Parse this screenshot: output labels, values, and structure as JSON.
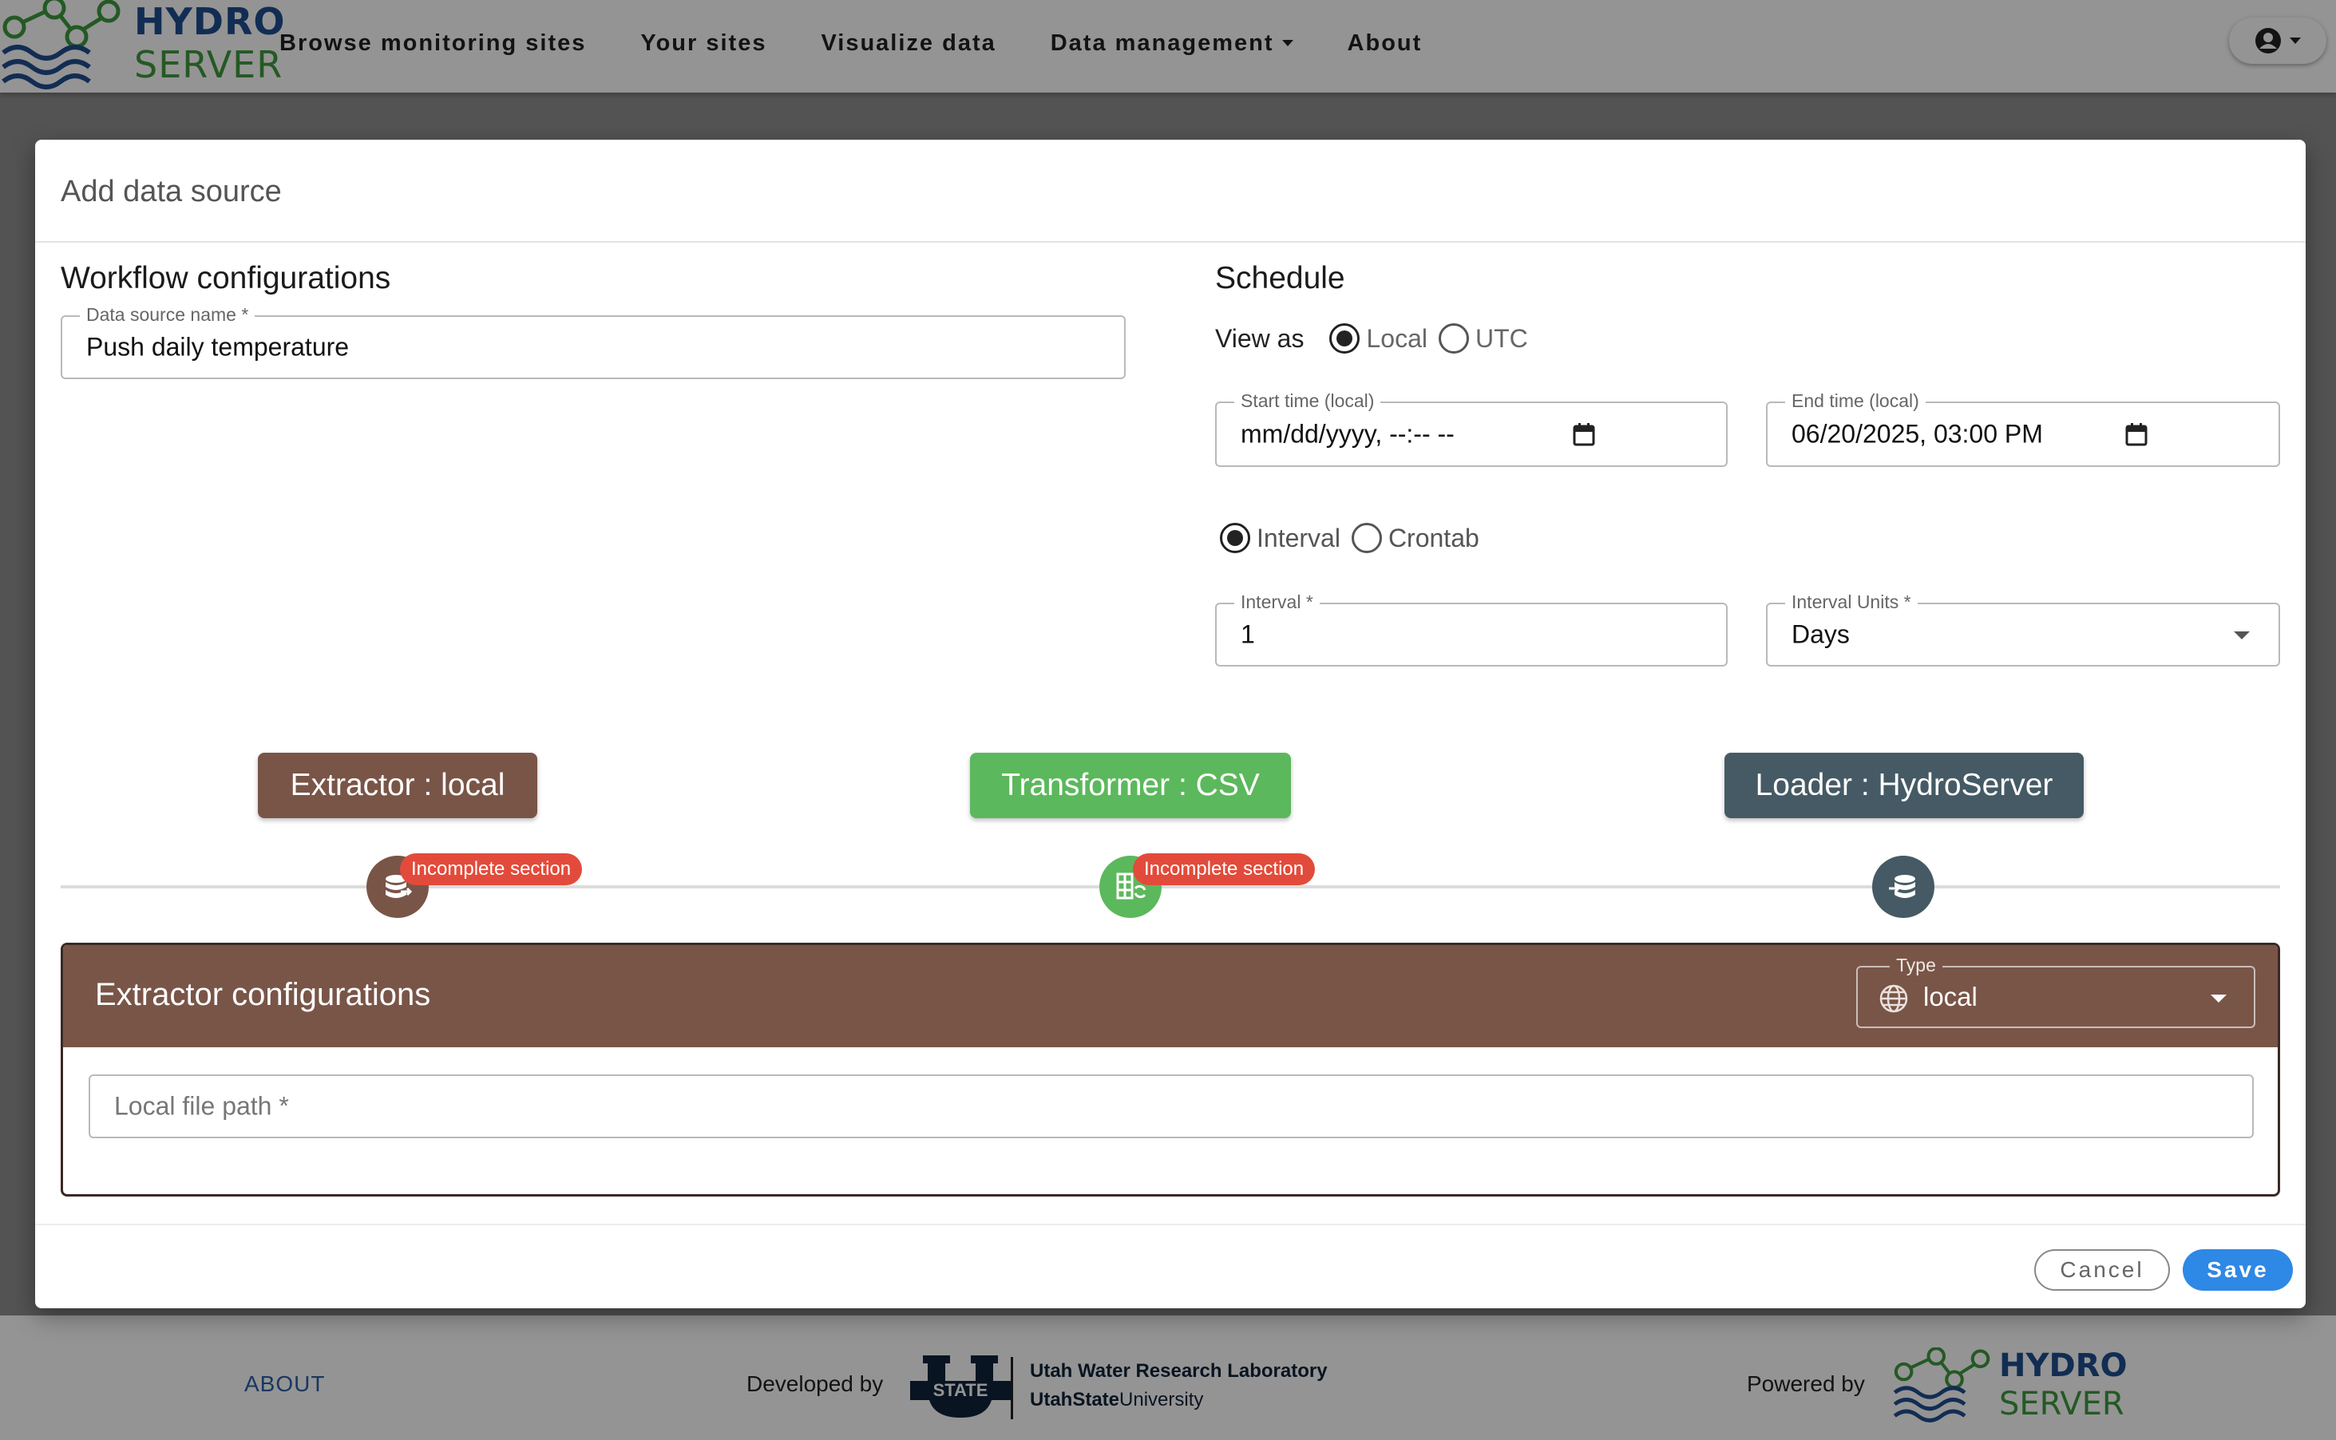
{
  "app": {
    "brand_top": "HYDRO",
    "brand_bottom": "SERVER",
    "nav": [
      {
        "label": "Browse monitoring sites"
      },
      {
        "label": "Your sites"
      },
      {
        "label": "Visualize data"
      },
      {
        "label": "Data management"
      },
      {
        "label": "About"
      }
    ]
  },
  "dialog": {
    "title": "Add data source",
    "workflow": {
      "heading": "Workflow configurations",
      "name_label": "Data source name *",
      "name_value": "Push daily temperature"
    },
    "schedule": {
      "heading": "Schedule",
      "view_as_label": "View as",
      "view_local": "Local",
      "view_utc": "UTC",
      "view_selected": "Local",
      "start_label": "Start time (local)",
      "start_value": "mm/dd/yyyy, --:-- --",
      "end_label": "End time (local)",
      "end_value": "06/20/2025, 03:00 PM",
      "mode_interval": "Interval",
      "mode_crontab": "Crontab",
      "mode_selected": "Interval",
      "interval_label": "Interval *",
      "interval_value": "1",
      "units_label": "Interval Units *",
      "units_value": "Days"
    },
    "pipeline": {
      "extractor": "Extractor : local",
      "transformer": "Transformer : CSV",
      "loader": "Loader : HydroServer",
      "incomplete": "Incomplete section",
      "colors": {
        "extractor": "#795548",
        "transformer": "#5cb85c",
        "loader": "#455a64"
      }
    },
    "extractor": {
      "heading": "Extractor configurations",
      "type_label": "Type",
      "type_value": "local",
      "path_placeholder": "Local file path *"
    },
    "actions": {
      "cancel": "Cancel",
      "save": "Save"
    }
  },
  "footer": {
    "about": "ABOUT",
    "developed_by": "Developed by",
    "usu_logo_text": "STATE",
    "usu_line1": "Utah Water Research Laboratory",
    "usu_line2_bold": "UtahState",
    "usu_line2_rest": "University",
    "powered_by": "Powered by",
    "brand_top": "HYDRO",
    "brand_bottom": "SERVER"
  }
}
